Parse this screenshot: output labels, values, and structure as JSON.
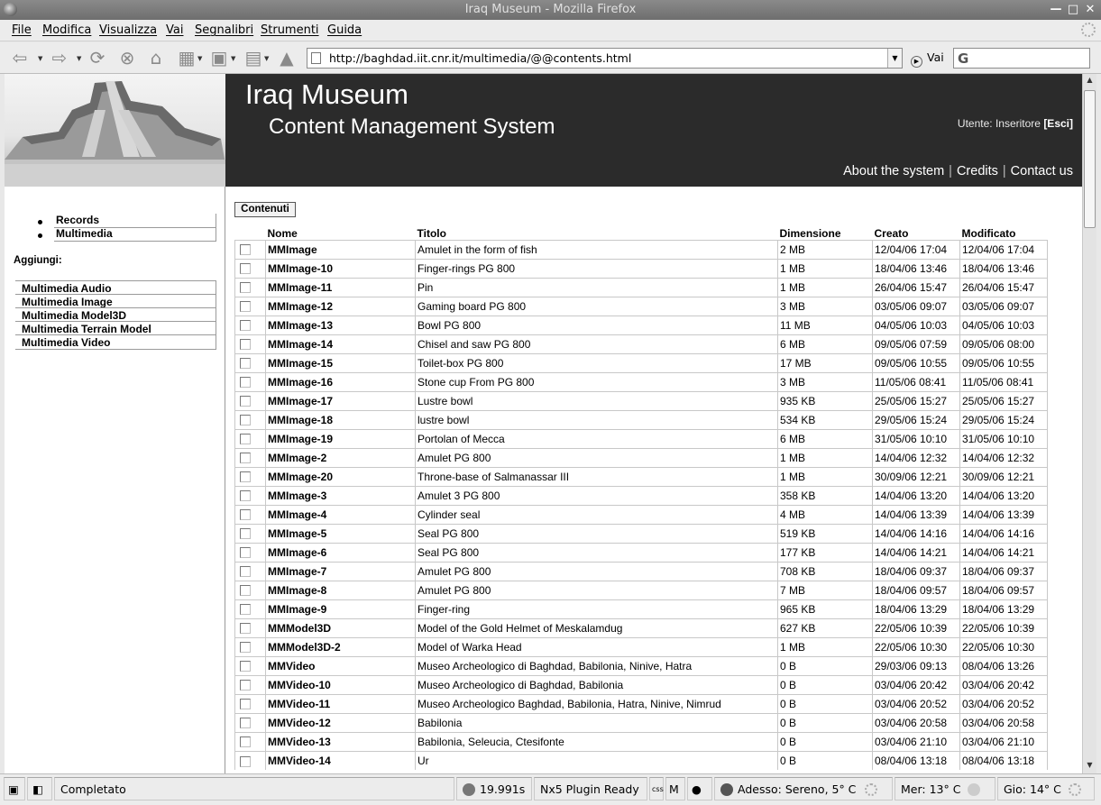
{
  "window": {
    "title": "Iraq Museum - Mozilla Firefox"
  },
  "menu": [
    "File",
    "Modifica",
    "Visualizza",
    "Vai",
    "Segnalibri",
    "Strumenti",
    "Guida"
  ],
  "toolbar": {
    "url": "http://baghdad.iit.cnr.it/multimedia/@@contents.html",
    "go_label": "Vai"
  },
  "header": {
    "title": "Iraq Museum",
    "subtitle": "Content Management System",
    "user_label": "Utente: Inseritore",
    "logout_label": "[Esci]",
    "links": [
      "About the system",
      "Credits",
      "Contact us"
    ]
  },
  "sidebar": {
    "nav": [
      "Records",
      "Multimedia"
    ],
    "add_label": "Aggiungi:",
    "add_items": [
      "Multimedia Audio",
      "Multimedia Image",
      "Multimedia Model3D",
      "Multimedia Terrain Model",
      "Multimedia Video"
    ]
  },
  "contents": {
    "tab_label": "Contenuti",
    "columns": [
      "Nome",
      "Titolo",
      "Dimensione",
      "Creato",
      "Modificato"
    ],
    "rows": [
      [
        "MMImage",
        "Amulet in the form of fish",
        "2 MB",
        "12/04/06 17:04",
        "12/04/06 17:04"
      ],
      [
        "MMImage-10",
        "Finger-rings PG 800",
        "1 MB",
        "18/04/06 13:46",
        "18/04/06 13:46"
      ],
      [
        "MMImage-11",
        "Pin",
        "1 MB",
        "26/04/06 15:47",
        "26/04/06 15:47"
      ],
      [
        "MMImage-12",
        "Gaming board PG 800",
        "3 MB",
        "03/05/06 09:07",
        "03/05/06 09:07"
      ],
      [
        "MMImage-13",
        "Bowl PG 800",
        "11 MB",
        "04/05/06 10:03",
        "04/05/06 10:03"
      ],
      [
        "MMImage-14",
        "Chisel and saw PG 800",
        "6 MB",
        "09/05/06 07:59",
        "09/05/06 08:00"
      ],
      [
        "MMImage-15",
        "Toilet-box PG 800",
        "17 MB",
        "09/05/06 10:55",
        "09/05/06 10:55"
      ],
      [
        "MMImage-16",
        "Stone cup From PG 800",
        "3 MB",
        "11/05/06 08:41",
        "11/05/06 08:41"
      ],
      [
        "MMImage-17",
        "Lustre bowl",
        "935 KB",
        "25/05/06 15:27",
        "25/05/06 15:27"
      ],
      [
        "MMImage-18",
        "lustre bowl",
        "534 KB",
        "29/05/06 15:24",
        "29/05/06 15:24"
      ],
      [
        "MMImage-19",
        "Portolan of Mecca",
        "6 MB",
        "31/05/06 10:10",
        "31/05/06 10:10"
      ],
      [
        "MMImage-2",
        "Amulet PG 800",
        "1 MB",
        "14/04/06 12:32",
        "14/04/06 12:32"
      ],
      [
        "MMImage-20",
        "Throne-base of Salmanassar III",
        "1 MB",
        "30/09/06 12:21",
        "30/09/06 12:21"
      ],
      [
        "MMImage-3",
        "Amulet 3 PG 800",
        "358 KB",
        "14/04/06 13:20",
        "14/04/06 13:20"
      ],
      [
        "MMImage-4",
        "Cylinder seal",
        "4 MB",
        "14/04/06 13:39",
        "14/04/06 13:39"
      ],
      [
        "MMImage-5",
        "Seal PG 800",
        "519 KB",
        "14/04/06 14:16",
        "14/04/06 14:16"
      ],
      [
        "MMImage-6",
        "Seal PG 800",
        "177 KB",
        "14/04/06 14:21",
        "14/04/06 14:21"
      ],
      [
        "MMImage-7",
        "Amulet PG 800",
        "708 KB",
        "18/04/06 09:37",
        "18/04/06 09:37"
      ],
      [
        "MMImage-8",
        "Amulet PG 800",
        "7 MB",
        "18/04/06 09:57",
        "18/04/06 09:57"
      ],
      [
        "MMImage-9",
        "Finger-ring",
        "965 KB",
        "18/04/06 13:29",
        "18/04/06 13:29"
      ],
      [
        "MMModel3D",
        "Model of the Gold Helmet of Meskalamdug",
        "627 KB",
        "22/05/06 10:39",
        "22/05/06 10:39"
      ],
      [
        "MMModel3D-2",
        "Model of Warka Head",
        "1 MB",
        "22/05/06 10:30",
        "22/05/06 10:30"
      ],
      [
        "MMVideo",
        "Museo Archeologico di Baghdad, Babilonia, Ninive, Hatra",
        "0 B",
        "29/03/06 09:13",
        "08/04/06 13:26"
      ],
      [
        "MMVideo-10",
        "Museo Archeologico di Baghdad, Babilonia",
        "0 B",
        "03/04/06 20:42",
        "03/04/06 20:42"
      ],
      [
        "MMVideo-11",
        "Museo Archeologico Baghdad, Babilonia, Hatra, Ninive, Nimrud",
        "0 B",
        "03/04/06 20:52",
        "03/04/06 20:52"
      ],
      [
        "MMVideo-12",
        "Babilonia",
        "0 B",
        "03/04/06 20:58",
        "03/04/06 20:58"
      ],
      [
        "MMVideo-13",
        "Babilonia, Seleucia, Ctesifonte",
        "0 B",
        "03/04/06 21:10",
        "03/04/06 21:10"
      ],
      [
        "MMVideo-14",
        "Ur",
        "0 B",
        "08/04/06 13:18",
        "08/04/06 13:18"
      ]
    ]
  },
  "status": {
    "text": "Completato",
    "timer": "19.991s",
    "plugin": "Nx5 Plugin Ready",
    "weather_now": "Adesso: Sereno, 5° C",
    "weather_wed": "Mer: 13° C",
    "weather_thu": "Gio: 14° C"
  }
}
